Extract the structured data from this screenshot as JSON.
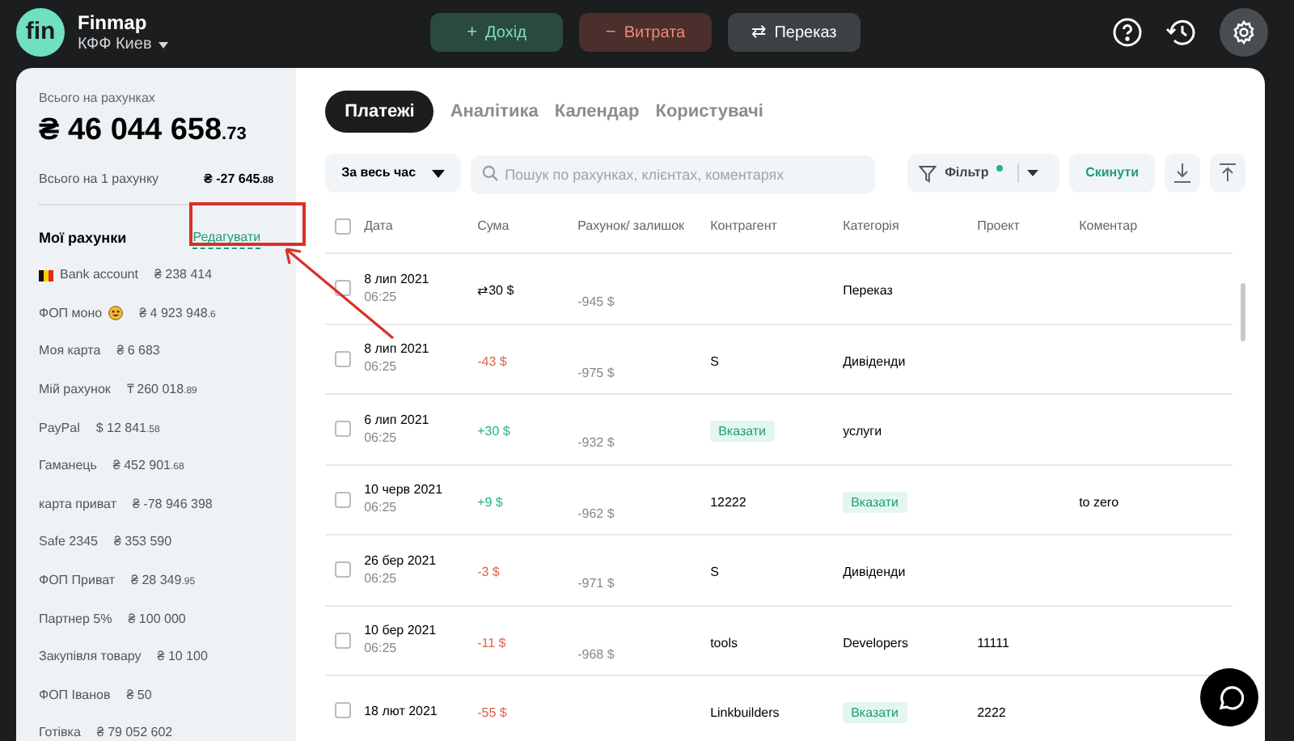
{
  "brand": {
    "logo": "fin",
    "name": "Finmap",
    "company": "КФФ Киев"
  },
  "actions": [
    {
      "kind": "income",
      "icon": "+",
      "label": "Дохід"
    },
    {
      "kind": "expense",
      "icon": "−",
      "label": "Витрата"
    },
    {
      "kind": "transfer",
      "icon": "⇄",
      "label": "Переказ"
    }
  ],
  "summary": {
    "total_label": "Всього на рахунках",
    "total": "₴ 46 044 658",
    "total_decimals": ".73",
    "per_account_label": "Всього на 1 рахунку",
    "per_account": "₴ -27 645",
    "per_account_decimals": ".88"
  },
  "accounts_section": {
    "title": "Мої рахунки",
    "edit_link": "Редагувати"
  },
  "accounts": [
    {
      "kind": "flag",
      "name": "Bank account",
      "amount": "₴ 238 414"
    },
    {
      "kind": "emoji",
      "name": "ФОП моно",
      "amount": "₴ 4 923 948",
      "decimals": ".6"
    },
    {
      "kind": "plain",
      "name": "Моя карта",
      "amount": "₴ 6 683"
    },
    {
      "kind": "plain",
      "name": "Мій рахунок",
      "amount": "₸ 260 018",
      "decimals": ".89"
    },
    {
      "kind": "plain",
      "name": "PayPal",
      "amount": "$ 12 841",
      "decimals": ".58"
    },
    {
      "kind": "plain",
      "name": "Гаманець",
      "amount": "₴ 452 901",
      "decimals": ".68"
    },
    {
      "kind": "plain",
      "name": "карта приват",
      "amount": "₴ -78 946 398"
    },
    {
      "kind": "plain",
      "name": "Safe 2345",
      "amount": "₴ 353 590"
    },
    {
      "kind": "plain",
      "name": "ФОП Приват",
      "amount": "₴ 28 349",
      "decimals": ".95"
    },
    {
      "kind": "plain",
      "name": "Партнер 5%",
      "amount": "₴ 100 000"
    },
    {
      "kind": "plain",
      "name": "Закупівля товару",
      "amount": "₴ 10 100"
    },
    {
      "kind": "plain",
      "name": "ФОП Іванов",
      "amount": "₴ 50"
    },
    {
      "kind": "plain",
      "name": "Готівка",
      "amount": "₴ 79 052 602"
    }
  ],
  "tabs": [
    {
      "label": "Платежі",
      "selected": true
    },
    {
      "label": "Аналітика",
      "selected": false
    },
    {
      "label": "Календар",
      "selected": false
    },
    {
      "label": "Користувачі",
      "selected": false
    }
  ],
  "toolbar": {
    "period": "За весь час",
    "search_placeholder": "Пошук по рахунках, клієнтах, коментарях",
    "filter": "Фільтр",
    "filter_active": true,
    "reset": "Скинути"
  },
  "table": {
    "select_all_checked": false,
    "columns": [
      "Дата",
      "Сума",
      "Рахунок/ залишок",
      "Контрагент",
      "Категорія",
      "Проект",
      "Коментар"
    ],
    "rows": [
      {
        "checked": false,
        "date": "8 лип 2021",
        "time": "06:25",
        "amount": {
          "kind": "transfer",
          "text": "⇄30 $"
        },
        "balance": "-945 $",
        "category": {
          "kind": "text",
          "text": "Переказ"
        }
      },
      {
        "checked": false,
        "date": "8 лип 2021",
        "time": "06:25",
        "amount": {
          "kind": "expense",
          "text": "-43 $"
        },
        "balance": "-975 $",
        "counterparty": {
          "kind": "text",
          "text": "S"
        },
        "category": {
          "kind": "text",
          "text": "Дивіденди"
        }
      },
      {
        "checked": false,
        "date": "6 лип 2021",
        "time": "06:25",
        "amount": {
          "kind": "income",
          "text": "+30 $"
        },
        "balance": "-932 $",
        "counterparty": {
          "kind": "tag",
          "text": "Вказати"
        },
        "category": {
          "kind": "text",
          "text": "услуги"
        }
      },
      {
        "checked": false,
        "date": "10 черв 2021",
        "time": "06:25",
        "amount": {
          "kind": "income",
          "text": "+9 $"
        },
        "balance": "-962 $",
        "counterparty": {
          "kind": "text",
          "text": "12222"
        },
        "category": {
          "kind": "tag",
          "text": "Вказати"
        },
        "comment": "to zero"
      },
      {
        "checked": false,
        "date": "26 бер 2021",
        "time": "06:25",
        "amount": {
          "kind": "expense",
          "text": "-3 $"
        },
        "balance": "-971 $",
        "counterparty": {
          "kind": "text",
          "text": "S"
        },
        "category": {
          "kind": "text",
          "text": "Дивіденди"
        }
      },
      {
        "checked": false,
        "date": "10 бер 2021",
        "time": "06:25",
        "amount": {
          "kind": "expense",
          "text": "-11 $"
        },
        "balance": "-968 $",
        "counterparty": {
          "kind": "text",
          "text": "tools"
        },
        "category": {
          "kind": "text",
          "text": "Developers"
        },
        "project": "11111"
      },
      {
        "checked": false,
        "date": "18 лют 2021",
        "amount": {
          "kind": "expense",
          "text": "-55 $"
        },
        "counterparty": {
          "kind": "text",
          "text": "Linkbuilders"
        },
        "category": {
          "kind": "tag",
          "text": "Вказати"
        },
        "project": "2222"
      }
    ]
  }
}
